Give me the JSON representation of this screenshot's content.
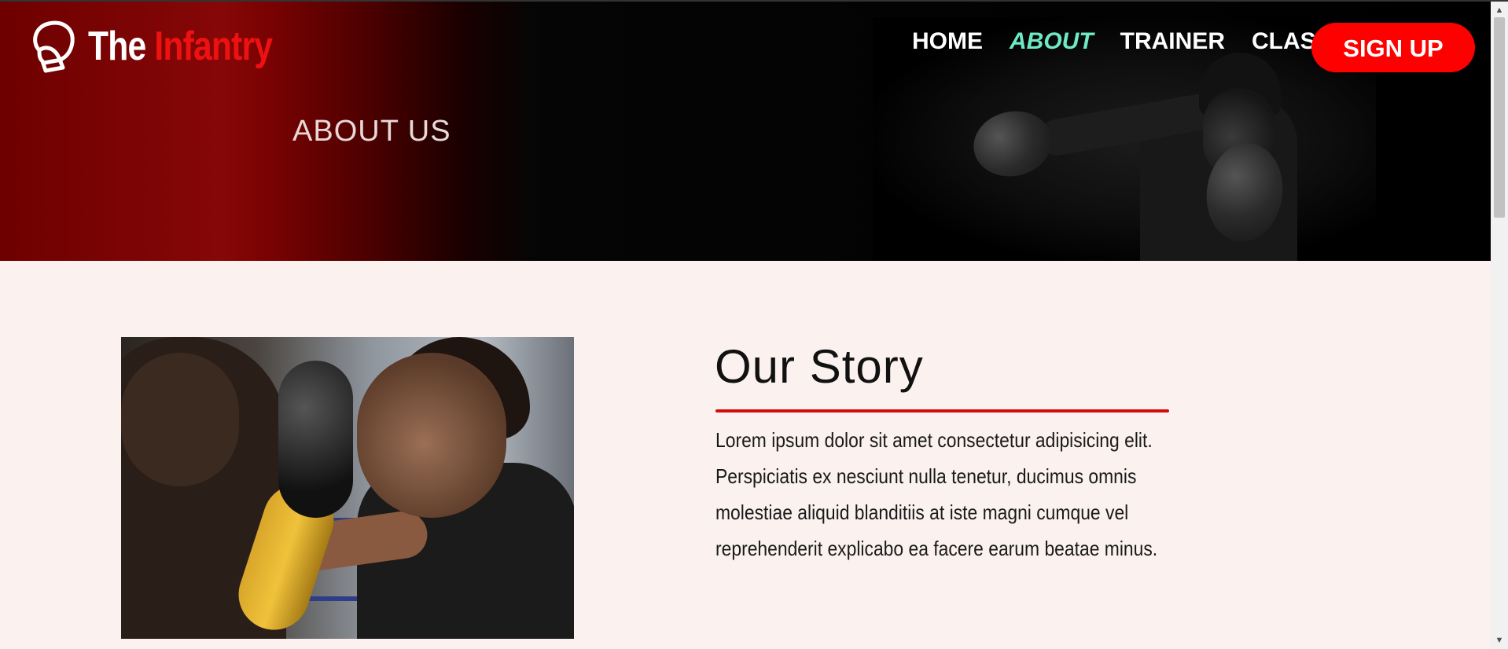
{
  "brand": {
    "name_part1": "The",
    "name_part2": "Infantry",
    "accent_color": "#ee1111"
  },
  "nav": {
    "items": [
      {
        "label": "HOME",
        "active": false
      },
      {
        "label": "ABOUT",
        "active": true
      },
      {
        "label": "TRAINER",
        "active": false
      },
      {
        "label": "CLASSES",
        "active": false
      }
    ],
    "active_color": "#6fe8c4",
    "signup_label": "SIGN UP",
    "signup_color": "#ff0000"
  },
  "hero": {
    "heading": "ABOUT US"
  },
  "story": {
    "title": "Our Story",
    "rule_color": "#d10c0c",
    "text": "Lorem ipsum dolor sit amet consectetur adipisicing elit. Perspiciatis ex nesciunt nulla tenetur, ducimus omnis molestiae aliquid blanditiis at iste magni cumque vel reprehenderit explicabo ea facere earum beatae minus."
  },
  "icons": {
    "logo": "boxing-glove-icon",
    "scroll_up": "triangle-up-icon",
    "scroll_down": "triangle-down-icon"
  }
}
